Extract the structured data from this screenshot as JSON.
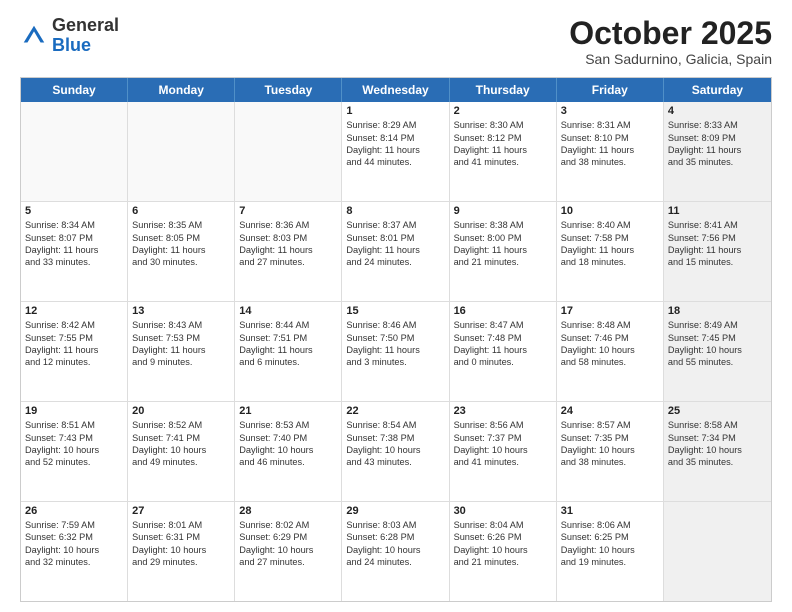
{
  "header": {
    "logo_general": "General",
    "logo_blue": "Blue",
    "month_title": "October 2025",
    "location": "San Sadurnino, Galicia, Spain"
  },
  "calendar": {
    "days": [
      "Sunday",
      "Monday",
      "Tuesday",
      "Wednesday",
      "Thursday",
      "Friday",
      "Saturday"
    ],
    "rows": [
      [
        {
          "day": "",
          "empty": true
        },
        {
          "day": "",
          "empty": true
        },
        {
          "day": "",
          "empty": true
        },
        {
          "day": "1",
          "text": "Sunrise: 8:29 AM\nSunset: 8:14 PM\nDaylight: 11 hours\nand 44 minutes."
        },
        {
          "day": "2",
          "text": "Sunrise: 8:30 AM\nSunset: 8:12 PM\nDaylight: 11 hours\nand 41 minutes."
        },
        {
          "day": "3",
          "text": "Sunrise: 8:31 AM\nSunset: 8:10 PM\nDaylight: 11 hours\nand 38 minutes."
        },
        {
          "day": "4",
          "text": "Sunrise: 8:33 AM\nSunset: 8:09 PM\nDaylight: 11 hours\nand 35 minutes.",
          "shaded": true
        }
      ],
      [
        {
          "day": "5",
          "text": "Sunrise: 8:34 AM\nSunset: 8:07 PM\nDaylight: 11 hours\nand 33 minutes."
        },
        {
          "day": "6",
          "text": "Sunrise: 8:35 AM\nSunset: 8:05 PM\nDaylight: 11 hours\nand 30 minutes."
        },
        {
          "day": "7",
          "text": "Sunrise: 8:36 AM\nSunset: 8:03 PM\nDaylight: 11 hours\nand 27 minutes."
        },
        {
          "day": "8",
          "text": "Sunrise: 8:37 AM\nSunset: 8:01 PM\nDaylight: 11 hours\nand 24 minutes."
        },
        {
          "day": "9",
          "text": "Sunrise: 8:38 AM\nSunset: 8:00 PM\nDaylight: 11 hours\nand 21 minutes."
        },
        {
          "day": "10",
          "text": "Sunrise: 8:40 AM\nSunset: 7:58 PM\nDaylight: 11 hours\nand 18 minutes."
        },
        {
          "day": "11",
          "text": "Sunrise: 8:41 AM\nSunset: 7:56 PM\nDaylight: 11 hours\nand 15 minutes.",
          "shaded": true
        }
      ],
      [
        {
          "day": "12",
          "text": "Sunrise: 8:42 AM\nSunset: 7:55 PM\nDaylight: 11 hours\nand 12 minutes."
        },
        {
          "day": "13",
          "text": "Sunrise: 8:43 AM\nSunset: 7:53 PM\nDaylight: 11 hours\nand 9 minutes."
        },
        {
          "day": "14",
          "text": "Sunrise: 8:44 AM\nSunset: 7:51 PM\nDaylight: 11 hours\nand 6 minutes."
        },
        {
          "day": "15",
          "text": "Sunrise: 8:46 AM\nSunset: 7:50 PM\nDaylight: 11 hours\nand 3 minutes."
        },
        {
          "day": "16",
          "text": "Sunrise: 8:47 AM\nSunset: 7:48 PM\nDaylight: 11 hours\nand 0 minutes."
        },
        {
          "day": "17",
          "text": "Sunrise: 8:48 AM\nSunset: 7:46 PM\nDaylight: 10 hours\nand 58 minutes."
        },
        {
          "day": "18",
          "text": "Sunrise: 8:49 AM\nSunset: 7:45 PM\nDaylight: 10 hours\nand 55 minutes.",
          "shaded": true
        }
      ],
      [
        {
          "day": "19",
          "text": "Sunrise: 8:51 AM\nSunset: 7:43 PM\nDaylight: 10 hours\nand 52 minutes."
        },
        {
          "day": "20",
          "text": "Sunrise: 8:52 AM\nSunset: 7:41 PM\nDaylight: 10 hours\nand 49 minutes."
        },
        {
          "day": "21",
          "text": "Sunrise: 8:53 AM\nSunset: 7:40 PM\nDaylight: 10 hours\nand 46 minutes."
        },
        {
          "day": "22",
          "text": "Sunrise: 8:54 AM\nSunset: 7:38 PM\nDaylight: 10 hours\nand 43 minutes."
        },
        {
          "day": "23",
          "text": "Sunrise: 8:56 AM\nSunset: 7:37 PM\nDaylight: 10 hours\nand 41 minutes."
        },
        {
          "day": "24",
          "text": "Sunrise: 8:57 AM\nSunset: 7:35 PM\nDaylight: 10 hours\nand 38 minutes."
        },
        {
          "day": "25",
          "text": "Sunrise: 8:58 AM\nSunset: 7:34 PM\nDaylight: 10 hours\nand 35 minutes.",
          "shaded": true
        }
      ],
      [
        {
          "day": "26",
          "text": "Sunrise: 7:59 AM\nSunset: 6:32 PM\nDaylight: 10 hours\nand 32 minutes."
        },
        {
          "day": "27",
          "text": "Sunrise: 8:01 AM\nSunset: 6:31 PM\nDaylight: 10 hours\nand 29 minutes."
        },
        {
          "day": "28",
          "text": "Sunrise: 8:02 AM\nSunset: 6:29 PM\nDaylight: 10 hours\nand 27 minutes."
        },
        {
          "day": "29",
          "text": "Sunrise: 8:03 AM\nSunset: 6:28 PM\nDaylight: 10 hours\nand 24 minutes."
        },
        {
          "day": "30",
          "text": "Sunrise: 8:04 AM\nSunset: 6:26 PM\nDaylight: 10 hours\nand 21 minutes."
        },
        {
          "day": "31",
          "text": "Sunrise: 8:06 AM\nSunset: 6:25 PM\nDaylight: 10 hours\nand 19 minutes."
        },
        {
          "day": "",
          "empty": true,
          "shaded": true
        }
      ]
    ]
  }
}
